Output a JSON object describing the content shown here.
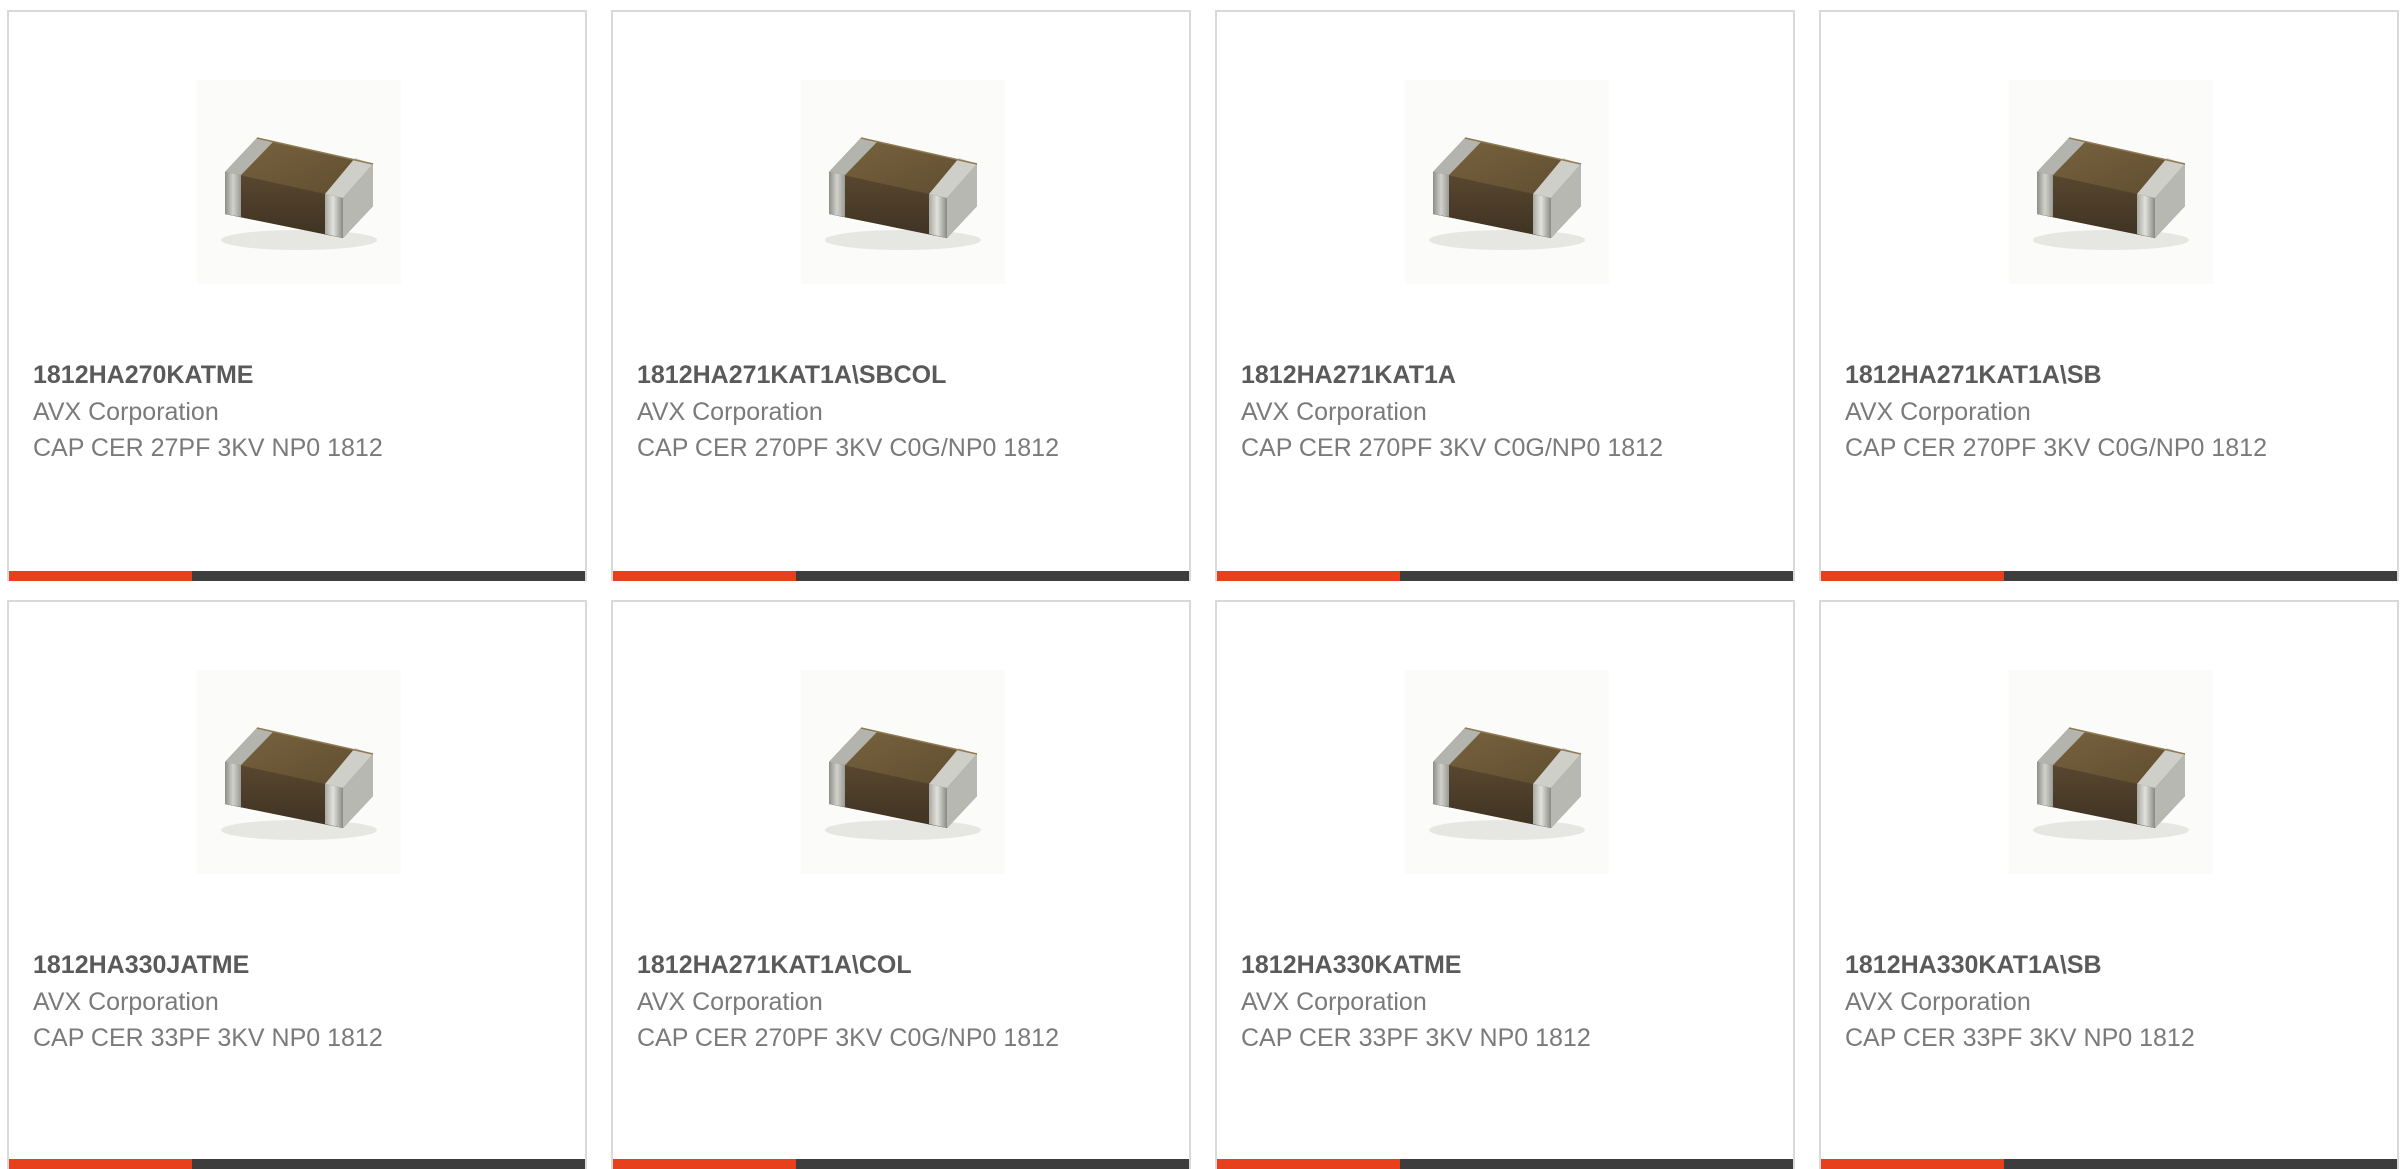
{
  "colors": {
    "accent_orange": "#e8401c",
    "accent_dark": "#3d3d3d",
    "part_number_text": "#5a5a5a",
    "secondary_text": "#7a7a7a",
    "card_border": "#d9d9d9"
  },
  "products": [
    {
      "part_number": "1812HA270KATME",
      "manufacturer": "AVX Corporation",
      "description": "CAP CER 27PF 3KV NP0 1812",
      "image": "ceramic-capacitor-chip-icon"
    },
    {
      "part_number": "1812HA271KAT1A\\SBCOL",
      "manufacturer": "AVX Corporation",
      "description": "CAP CER 270PF 3KV C0G/NP0 1812",
      "image": "ceramic-capacitor-chip-icon"
    },
    {
      "part_number": "1812HA271KAT1A",
      "manufacturer": "AVX Corporation",
      "description": "CAP CER 270PF 3KV C0G/NP0 1812",
      "image": "ceramic-capacitor-chip-icon"
    },
    {
      "part_number": "1812HA271KAT1A\\SB",
      "manufacturer": "AVX Corporation",
      "description": "CAP CER 270PF 3KV C0G/NP0 1812",
      "image": "ceramic-capacitor-chip-icon"
    },
    {
      "part_number": "1812HA330JATME",
      "manufacturer": "AVX Corporation",
      "description": "CAP CER 33PF 3KV NP0 1812",
      "image": "ceramic-capacitor-chip-icon"
    },
    {
      "part_number": "1812HA271KAT1A\\COL",
      "manufacturer": "AVX Corporation",
      "description": "CAP CER 270PF 3KV C0G/NP0 1812",
      "image": "ceramic-capacitor-chip-icon"
    },
    {
      "part_number": "1812HA330KATME",
      "manufacturer": "AVX Corporation",
      "description": "CAP CER 33PF 3KV NP0 1812",
      "image": "ceramic-capacitor-chip-icon"
    },
    {
      "part_number": "1812HA330KAT1A\\SB",
      "manufacturer": "AVX Corporation",
      "description": "CAP CER 33PF 3KV NP0 1812",
      "image": "ceramic-capacitor-chip-icon"
    }
  ]
}
